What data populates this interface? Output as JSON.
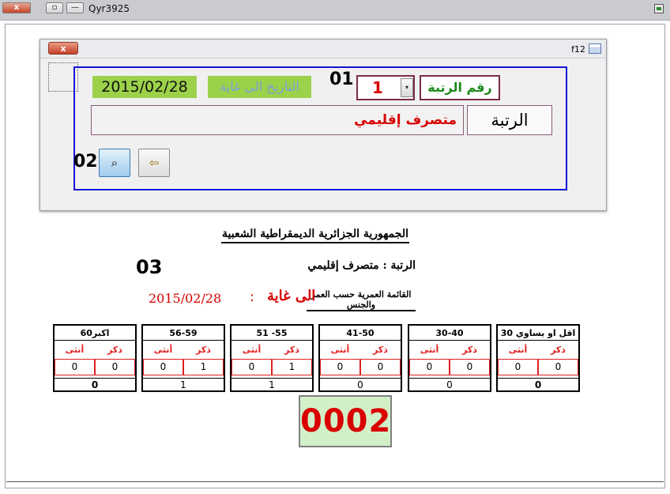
{
  "window": {
    "title": "Qyr3925",
    "close_glyph": "x",
    "restore_glyph": "▫",
    "min_glyph": "—"
  },
  "dialog": {
    "caption": "f12",
    "close_glyph": "x",
    "date_value": "2015/02/28",
    "until_label": "التاريخ الى غاية",
    "label_01": "01",
    "rank_no_value": "1",
    "combo_arrow": "▾",
    "rank_no_label": "رقم الرتبة",
    "rank_value": "متصرف إقليمي",
    "rank_label": "الرتبة",
    "label_02": "02",
    "search_glyph": "⌕",
    "exit_glyph": "⇦"
  },
  "report": {
    "republic_title": "الجمهورية الجزائرية الديمقراطية الشعبية",
    "label_03": "03",
    "rank_line": "الرتبة : متصرف إقليمي",
    "list_title": "القائمة العمرية حسب العمر والجنس",
    "until_text": "الى غاية",
    "colon": ":",
    "date_text": "2015/02/28",
    "male_label": "ذكر",
    "female_label": "أنثى",
    "groups": [
      {
        "label": "اقل او يساوي 30",
        "male": "0",
        "female": "0",
        "total": "0"
      },
      {
        "label": "30-40",
        "male": "0",
        "female": "0",
        "total": "0"
      },
      {
        "label": "41-50",
        "male": "0",
        "female": "0",
        "total": "0"
      },
      {
        "label": "51 -55",
        "male": "1",
        "female": "0",
        "total": "1"
      },
      {
        "label": "56-59",
        "male": "1",
        "female": "0",
        "total": "1"
      },
      {
        "label": "60اكبر",
        "male": "0",
        "female": "0",
        "total": "0"
      }
    ],
    "grand_total": "0002"
  },
  "colors": {
    "accent_green": "#9cd14a",
    "alert_red": "#d80000",
    "frame_blue": "#1414d8"
  }
}
